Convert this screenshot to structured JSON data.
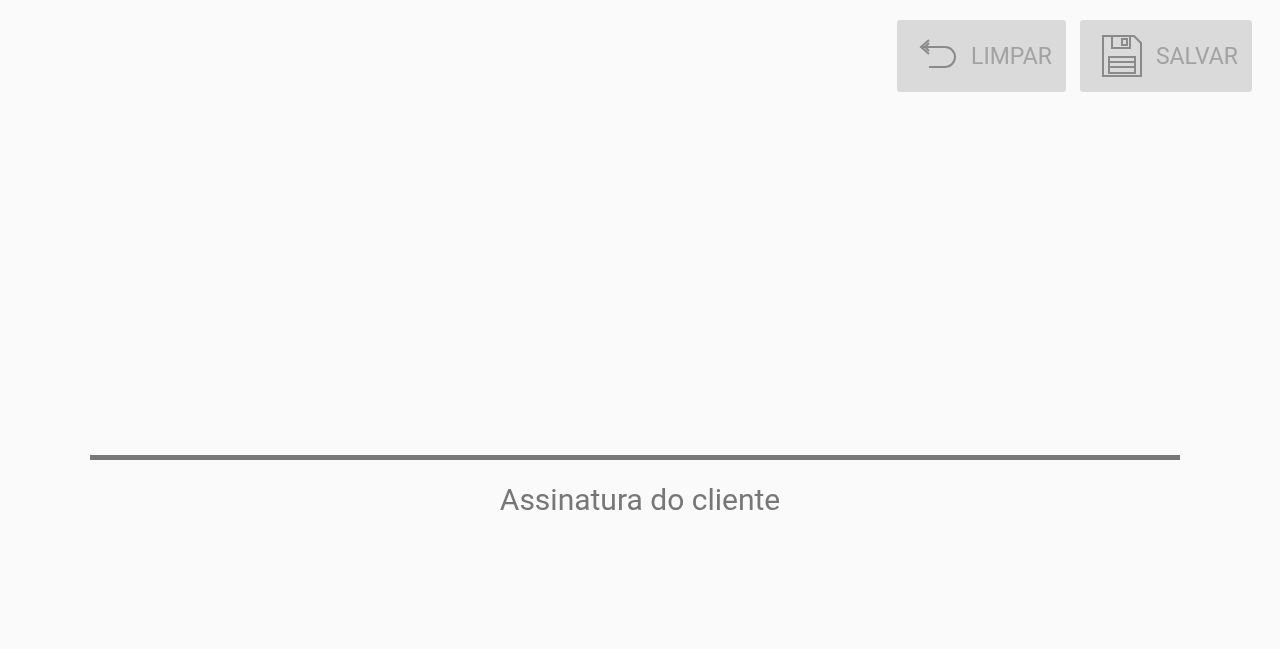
{
  "toolbar": {
    "buttons": [
      {
        "kind": "undo",
        "label": "LIMPAR",
        "disabled": true
      },
      {
        "kind": "save",
        "label": "SALVAR",
        "disabled": true
      }
    ]
  },
  "signature": {
    "label": "Assinatura do cliente"
  }
}
